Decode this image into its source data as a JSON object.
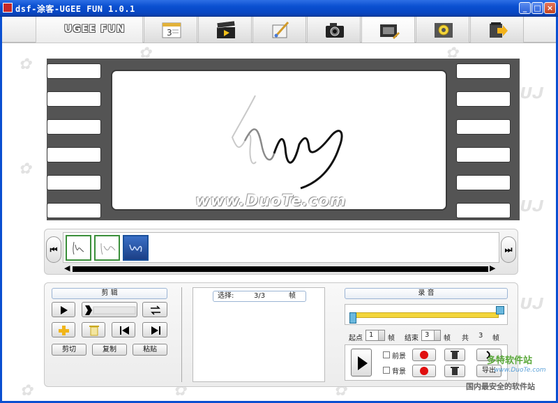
{
  "window": {
    "title": "dsf-涂客-UGEE FUN 1.0.1",
    "min_label": "_",
    "max_label": "□",
    "close_label": "×"
  },
  "toolbar": {
    "logo_text": "UGEE FUN",
    "tools": [
      {
        "id": "calendar",
        "icon": "calendar-icon",
        "badge": "3"
      },
      {
        "id": "movie",
        "icon": "clapperboard-icon"
      },
      {
        "id": "paint",
        "icon": "paint-brush-icon"
      },
      {
        "id": "camera",
        "icon": "camera-icon"
      },
      {
        "id": "edit-frame",
        "icon": "film-edit-icon",
        "active": true
      },
      {
        "id": "settings",
        "icon": "gear-icon"
      },
      {
        "id": "exit",
        "icon": "exit-arrow-icon"
      }
    ]
  },
  "preview": {
    "watermark": "www.DuoTe.com"
  },
  "timeline": {
    "prev_label": "⏮",
    "next_label": "⏭",
    "left_arrow": "◀",
    "right_arrow": "▶",
    "frames": [
      {
        "index": 1,
        "selected": false
      },
      {
        "index": 2,
        "selected": false
      },
      {
        "index": 3,
        "selected": true
      }
    ]
  },
  "edit": {
    "title": "剪 辑",
    "cut_label": "剪切",
    "copy_label": "复制",
    "paste_label": "粘贴"
  },
  "selection": {
    "label": "选择:",
    "value": "3/3",
    "unit": "帧"
  },
  "record": {
    "title": "录 音",
    "start_label": "起点",
    "start_value": "1",
    "start_unit": "帧",
    "end_label": "结束",
    "end_value": "3",
    "end_unit": "帧",
    "total_label": "共",
    "total_value": "3",
    "total_unit": "帧",
    "foreground_label": "前景",
    "background_label": "背景",
    "export_label": "导出"
  },
  "site_watermark": {
    "brand": "多特软件站",
    "url": "www.DuoTe.com",
    "slogan": "国内最安全的软件站"
  },
  "colors": {
    "titlebar": "#0a4fd1",
    "film": "#545454",
    "slider": "#f3d53a",
    "record": "#e01010"
  }
}
